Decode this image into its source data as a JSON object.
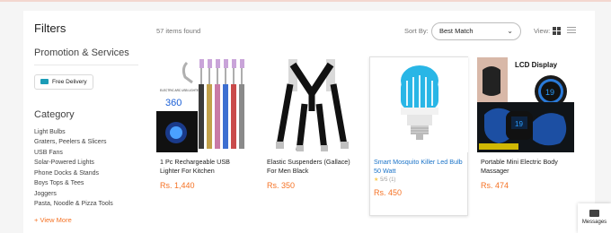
{
  "sidebar": {
    "title": "Filters",
    "promotion_title": "Promotion & Services",
    "promo_chip": "Free Delivery",
    "category_title": "Category",
    "categories": [
      "Light Bulbs",
      "Graters, Peelers & Slicers",
      "USB Fans",
      "Solar-Powered Lights",
      "Phone Docks & Stands",
      "Boys Tops & Tees",
      "Joggers",
      "Pasta, Noodle & Pizza Tools"
    ],
    "view_more": "+ View More"
  },
  "toolbar": {
    "items_found": "57 items found",
    "sort_label": "Sort By:",
    "sort_value": "Best Match",
    "view_label": "View:"
  },
  "products": [
    {
      "title": "1 Pc Rechargeable USB Lighter For Kitchen",
      "price": "Rs. 1,440",
      "image_text": "360",
      "image_caption": "ELECTRIC ARC USB LIGHTER"
    },
    {
      "title": "Elastic Suspenders (Gallace) For Men Black",
      "price": "Rs. 350"
    },
    {
      "title": "Smart Mosquito Killer Led Bulb 50 Watt",
      "rating": "5/5 (1)",
      "price": "Rs. 450"
    },
    {
      "title": "Portable Mini Electric Body Massager",
      "price": "Rs. 474",
      "image_text": "LCD Display",
      "image_digits": "19"
    }
  ],
  "messages_label": "Messages",
  "colors": {
    "accent": "#f57224",
    "link": "#1a73c8",
    "background": "#f5f5f5"
  }
}
